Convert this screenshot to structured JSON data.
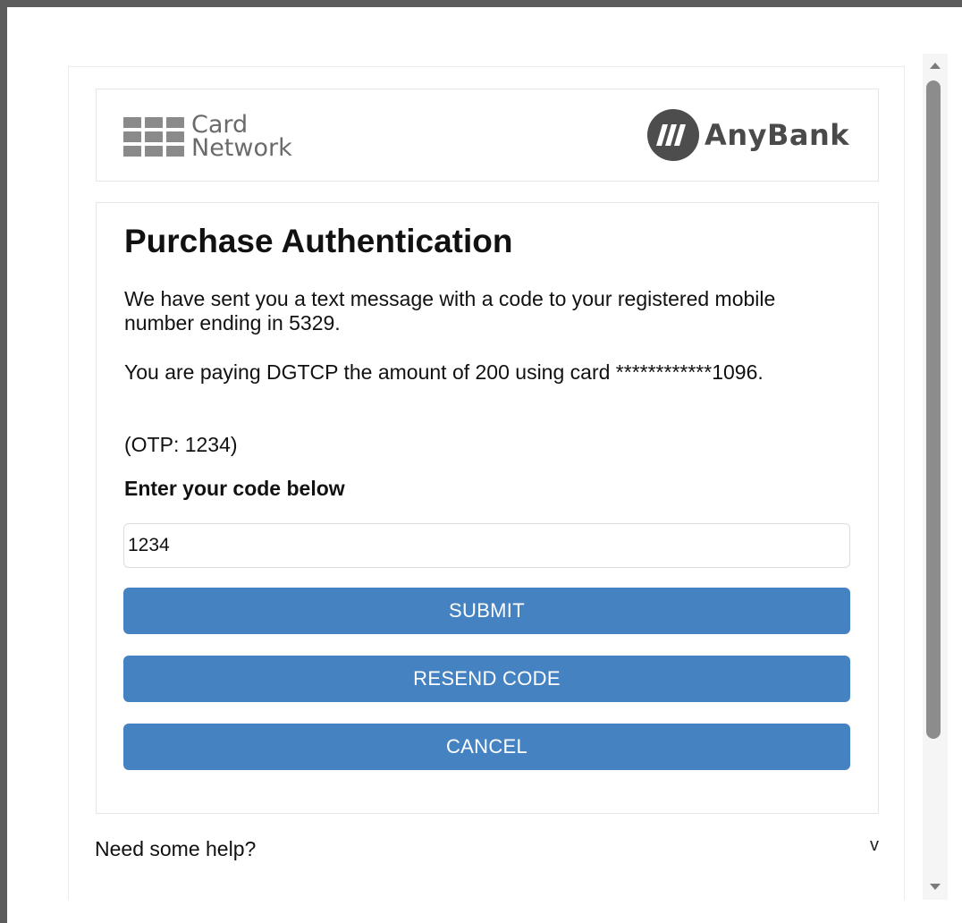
{
  "header": {
    "card_network_line1": "Card",
    "card_network_line2": "Network",
    "bank_name": "AnyBank"
  },
  "main": {
    "title": "Purchase Authentication",
    "message_sms": "We have sent you a text message with a code to your registered mobile number ending in 5329.",
    "message_payment": "You are paying DGTCP the amount of 200 using card ************1096.",
    "otp_hint": "(OTP: 1234)",
    "code_label": "Enter your code below",
    "code_input_value": "1234",
    "submit_label": "SUBMIT",
    "resend_label": "RESEND CODE",
    "cancel_label": "CANCEL"
  },
  "help": {
    "label": "Need some help?",
    "chevron": "v"
  },
  "colors": {
    "button_bg": "#4582c2",
    "button_text": "#ffffff",
    "logo_gray": "#4d4d4d"
  },
  "icons": {
    "card_network_logo": "grid-logo-icon",
    "bank_logo": "anybank-stripes-icon",
    "help_toggle": "chevron-down-icon"
  }
}
